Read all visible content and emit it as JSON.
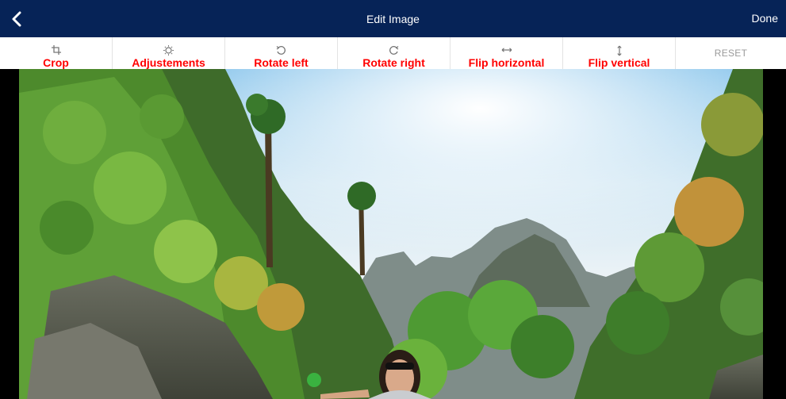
{
  "header": {
    "title": "Edit Image",
    "done_label": "Done",
    "back_icon": "chevron-left-icon",
    "background": "#062357"
  },
  "toolbar": {
    "items": [
      {
        "label": "Crop",
        "icon": "crop-icon"
      },
      {
        "label": "Adjustements",
        "icon": "sun-icon"
      },
      {
        "label": "Rotate left",
        "icon": "rotate-left-icon"
      },
      {
        "label": "Rotate right",
        "icon": "rotate-right-icon"
      },
      {
        "label": "Flip horizontal",
        "icon": "flip-horizontal-icon"
      },
      {
        "label": "Flip vertical",
        "icon": "flip-vertical-icon"
      },
      {
        "label": "RESET",
        "icon": ""
      }
    ],
    "label_color": "#ff0000"
  },
  "photo": {
    "subject": "woman with sunglasses in front of green limestone cliffs"
  }
}
